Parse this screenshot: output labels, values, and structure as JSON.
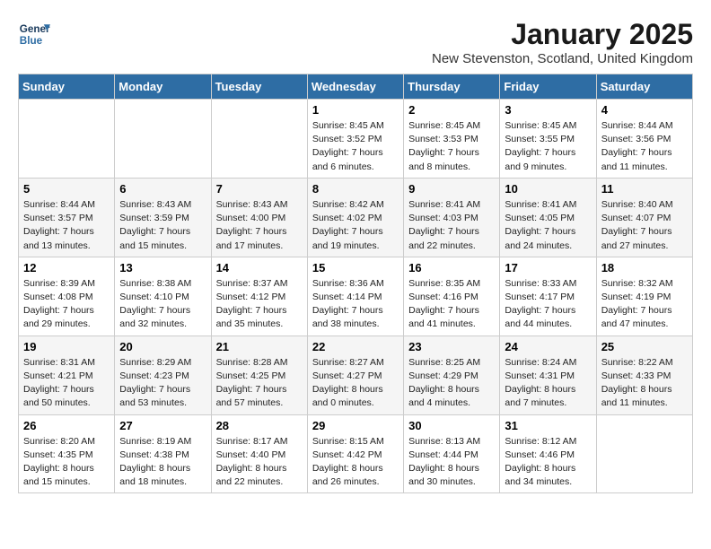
{
  "header": {
    "logo_line1": "General",
    "logo_line2": "Blue",
    "month_title": "January 2025",
    "location": "New Stevenston, Scotland, United Kingdom"
  },
  "weekdays": [
    "Sunday",
    "Monday",
    "Tuesday",
    "Wednesday",
    "Thursday",
    "Friday",
    "Saturday"
  ],
  "weeks": [
    [
      {
        "day": "",
        "sunrise": "",
        "sunset": "",
        "daylight": ""
      },
      {
        "day": "",
        "sunrise": "",
        "sunset": "",
        "daylight": ""
      },
      {
        "day": "",
        "sunrise": "",
        "sunset": "",
        "daylight": ""
      },
      {
        "day": "1",
        "sunrise": "Sunrise: 8:45 AM",
        "sunset": "Sunset: 3:52 PM",
        "daylight": "Daylight: 7 hours and 6 minutes."
      },
      {
        "day": "2",
        "sunrise": "Sunrise: 8:45 AM",
        "sunset": "Sunset: 3:53 PM",
        "daylight": "Daylight: 7 hours and 8 minutes."
      },
      {
        "day": "3",
        "sunrise": "Sunrise: 8:45 AM",
        "sunset": "Sunset: 3:55 PM",
        "daylight": "Daylight: 7 hours and 9 minutes."
      },
      {
        "day": "4",
        "sunrise": "Sunrise: 8:44 AM",
        "sunset": "Sunset: 3:56 PM",
        "daylight": "Daylight: 7 hours and 11 minutes."
      }
    ],
    [
      {
        "day": "5",
        "sunrise": "Sunrise: 8:44 AM",
        "sunset": "Sunset: 3:57 PM",
        "daylight": "Daylight: 7 hours and 13 minutes."
      },
      {
        "day": "6",
        "sunrise": "Sunrise: 8:43 AM",
        "sunset": "Sunset: 3:59 PM",
        "daylight": "Daylight: 7 hours and 15 minutes."
      },
      {
        "day": "7",
        "sunrise": "Sunrise: 8:43 AM",
        "sunset": "Sunset: 4:00 PM",
        "daylight": "Daylight: 7 hours and 17 minutes."
      },
      {
        "day": "8",
        "sunrise": "Sunrise: 8:42 AM",
        "sunset": "Sunset: 4:02 PM",
        "daylight": "Daylight: 7 hours and 19 minutes."
      },
      {
        "day": "9",
        "sunrise": "Sunrise: 8:41 AM",
        "sunset": "Sunset: 4:03 PM",
        "daylight": "Daylight: 7 hours and 22 minutes."
      },
      {
        "day": "10",
        "sunrise": "Sunrise: 8:41 AM",
        "sunset": "Sunset: 4:05 PM",
        "daylight": "Daylight: 7 hours and 24 minutes."
      },
      {
        "day": "11",
        "sunrise": "Sunrise: 8:40 AM",
        "sunset": "Sunset: 4:07 PM",
        "daylight": "Daylight: 7 hours and 27 minutes."
      }
    ],
    [
      {
        "day": "12",
        "sunrise": "Sunrise: 8:39 AM",
        "sunset": "Sunset: 4:08 PM",
        "daylight": "Daylight: 7 hours and 29 minutes."
      },
      {
        "day": "13",
        "sunrise": "Sunrise: 8:38 AM",
        "sunset": "Sunset: 4:10 PM",
        "daylight": "Daylight: 7 hours and 32 minutes."
      },
      {
        "day": "14",
        "sunrise": "Sunrise: 8:37 AM",
        "sunset": "Sunset: 4:12 PM",
        "daylight": "Daylight: 7 hours and 35 minutes."
      },
      {
        "day": "15",
        "sunrise": "Sunrise: 8:36 AM",
        "sunset": "Sunset: 4:14 PM",
        "daylight": "Daylight: 7 hours and 38 minutes."
      },
      {
        "day": "16",
        "sunrise": "Sunrise: 8:35 AM",
        "sunset": "Sunset: 4:16 PM",
        "daylight": "Daylight: 7 hours and 41 minutes."
      },
      {
        "day": "17",
        "sunrise": "Sunrise: 8:33 AM",
        "sunset": "Sunset: 4:17 PM",
        "daylight": "Daylight: 7 hours and 44 minutes."
      },
      {
        "day": "18",
        "sunrise": "Sunrise: 8:32 AM",
        "sunset": "Sunset: 4:19 PM",
        "daylight": "Daylight: 7 hours and 47 minutes."
      }
    ],
    [
      {
        "day": "19",
        "sunrise": "Sunrise: 8:31 AM",
        "sunset": "Sunset: 4:21 PM",
        "daylight": "Daylight: 7 hours and 50 minutes."
      },
      {
        "day": "20",
        "sunrise": "Sunrise: 8:29 AM",
        "sunset": "Sunset: 4:23 PM",
        "daylight": "Daylight: 7 hours and 53 minutes."
      },
      {
        "day": "21",
        "sunrise": "Sunrise: 8:28 AM",
        "sunset": "Sunset: 4:25 PM",
        "daylight": "Daylight: 7 hours and 57 minutes."
      },
      {
        "day": "22",
        "sunrise": "Sunrise: 8:27 AM",
        "sunset": "Sunset: 4:27 PM",
        "daylight": "Daylight: 8 hours and 0 minutes."
      },
      {
        "day": "23",
        "sunrise": "Sunrise: 8:25 AM",
        "sunset": "Sunset: 4:29 PM",
        "daylight": "Daylight: 8 hours and 4 minutes."
      },
      {
        "day": "24",
        "sunrise": "Sunrise: 8:24 AM",
        "sunset": "Sunset: 4:31 PM",
        "daylight": "Daylight: 8 hours and 7 minutes."
      },
      {
        "day": "25",
        "sunrise": "Sunrise: 8:22 AM",
        "sunset": "Sunset: 4:33 PM",
        "daylight": "Daylight: 8 hours and 11 minutes."
      }
    ],
    [
      {
        "day": "26",
        "sunrise": "Sunrise: 8:20 AM",
        "sunset": "Sunset: 4:35 PM",
        "daylight": "Daylight: 8 hours and 15 minutes."
      },
      {
        "day": "27",
        "sunrise": "Sunrise: 8:19 AM",
        "sunset": "Sunset: 4:38 PM",
        "daylight": "Daylight: 8 hours and 18 minutes."
      },
      {
        "day": "28",
        "sunrise": "Sunrise: 8:17 AM",
        "sunset": "Sunset: 4:40 PM",
        "daylight": "Daylight: 8 hours and 22 minutes."
      },
      {
        "day": "29",
        "sunrise": "Sunrise: 8:15 AM",
        "sunset": "Sunset: 4:42 PM",
        "daylight": "Daylight: 8 hours and 26 minutes."
      },
      {
        "day": "30",
        "sunrise": "Sunrise: 8:13 AM",
        "sunset": "Sunset: 4:44 PM",
        "daylight": "Daylight: 8 hours and 30 minutes."
      },
      {
        "day": "31",
        "sunrise": "Sunrise: 8:12 AM",
        "sunset": "Sunset: 4:46 PM",
        "daylight": "Daylight: 8 hours and 34 minutes."
      },
      {
        "day": "",
        "sunrise": "",
        "sunset": "",
        "daylight": ""
      }
    ]
  ]
}
